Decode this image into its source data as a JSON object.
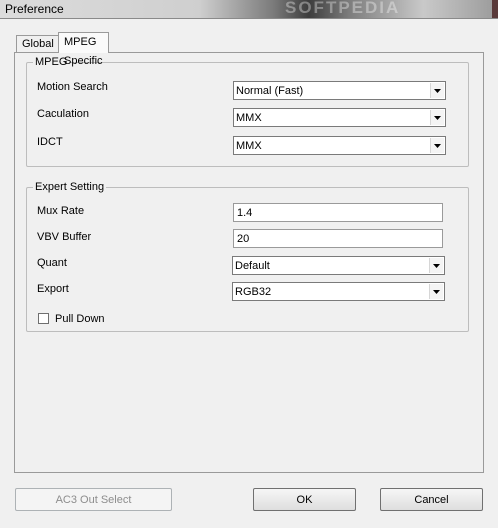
{
  "window": {
    "title": "Preference",
    "watermark": "SOFTPEDIA"
  },
  "tabs": [
    "Global",
    "MPEG Specific"
  ],
  "mpeg": {
    "legend": "MPEG",
    "fields": [
      {
        "label": "Motion Search",
        "value": "Normal (Fast)"
      },
      {
        "label": "Caculation",
        "value": "MMX"
      },
      {
        "label": "IDCT",
        "value": "MMX"
      }
    ]
  },
  "expert": {
    "legend": "Expert Setting",
    "mux_rate": {
      "label": "Mux Rate",
      "value": "1.4"
    },
    "vbv_buffer": {
      "label": "VBV Buffer",
      "value": "20"
    },
    "quant": {
      "label": "Quant",
      "value": "Default"
    },
    "export": {
      "label": "Export",
      "value": "RGB32"
    },
    "pull_down": {
      "label": "Pull Down",
      "checked": false
    }
  },
  "buttons": {
    "ac3": "AC3 Out Select",
    "ok": "OK",
    "cancel": "Cancel"
  },
  "icons": {
    "dropdown": "chevron-down-icon",
    "checkbox": "checkbox-icon"
  }
}
